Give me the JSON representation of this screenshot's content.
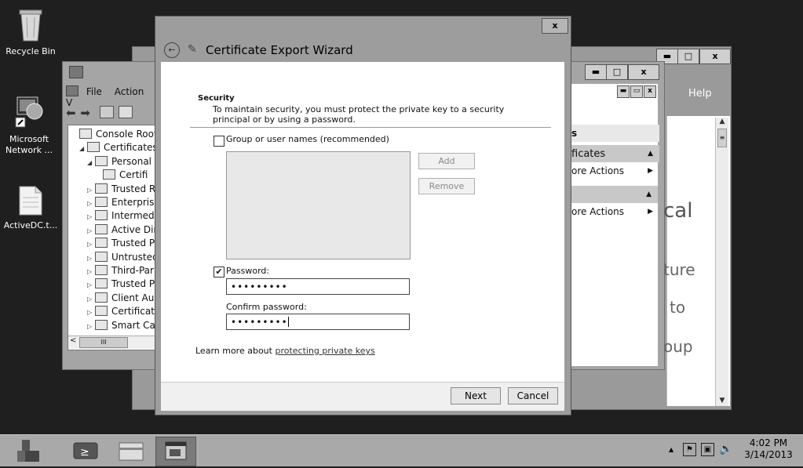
{
  "desktop": {
    "icons": [
      {
        "label": "Recycle Bin"
      },
      {
        "label": "Microsoft Network ..."
      },
      {
        "label": "ActiveDC.t..."
      }
    ]
  },
  "mmc": {
    "menu": [
      "File",
      "Action",
      "V"
    ],
    "tree": [
      {
        "label": "Console Root",
        "indent": 0,
        "exp": ""
      },
      {
        "label": "Certificates -",
        "indent": 1,
        "exp": "◢"
      },
      {
        "label": "Personal",
        "indent": 2,
        "exp": "◢"
      },
      {
        "label": "Certifi",
        "indent": 3,
        "exp": ""
      },
      {
        "label": "Trusted R",
        "indent": 2,
        "exp": "▷"
      },
      {
        "label": "Enterprise",
        "indent": 2,
        "exp": "▷"
      },
      {
        "label": "Intermedi",
        "indent": 2,
        "exp": "▷"
      },
      {
        "label": "Active Dir",
        "indent": 2,
        "exp": "▷"
      },
      {
        "label": "Trusted P",
        "indent": 2,
        "exp": "▷"
      },
      {
        "label": "Untrustec",
        "indent": 2,
        "exp": "▷"
      },
      {
        "label": "Third-Par",
        "indent": 2,
        "exp": "▷"
      },
      {
        "label": "Trusted P",
        "indent": 2,
        "exp": "▷"
      },
      {
        "label": "Client Au",
        "indent": 2,
        "exp": "▷"
      },
      {
        "label": "Certificate",
        "indent": 2,
        "exp": "▷"
      },
      {
        "label": "Smart Car",
        "indent": 2,
        "exp": "▷"
      }
    ],
    "scroll_thumb": "III",
    "actions": {
      "header": "s",
      "section1": "ficates",
      "more1": "ore Actions",
      "more2": "ore Actions"
    }
  },
  "back_window": {
    "help": "Help",
    "text_fragments": [
      "cal",
      "ture",
      "to",
      "oup"
    ]
  },
  "wizard": {
    "title": "Certificate Export Wizard",
    "close": "x",
    "section_title": "Security",
    "description": "To maintain security, you must protect the private key to a security principal or by using a password.",
    "group_checkbox_label": "Group or user names (recommended)",
    "group_checked": false,
    "add_button": "Add",
    "remove_button": "Remove",
    "password_checkbox_label": "Password:",
    "password_checked": true,
    "password_value": "•••••••••",
    "confirm_label": "Confirm password:",
    "confirm_value": "•••••••••",
    "learn_more_prefix": "Learn more about ",
    "learn_more_link": "protecting private keys",
    "next_button": "Next",
    "cancel_button": "Cancel"
  },
  "taskbar": {
    "clock_time": "4:02 PM",
    "clock_date": "3/14/2013",
    "tray_expand": "▲"
  }
}
